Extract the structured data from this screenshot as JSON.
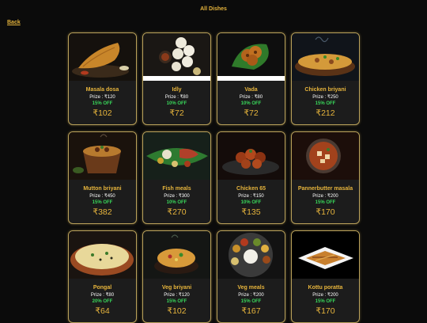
{
  "page": {
    "title": "All Dishes",
    "back_label": "Back"
  },
  "prize_prefix": "Prize : ",
  "dishes": [
    {
      "name": "Masala dosa",
      "prize": "Prize : ₹120",
      "discount": "15% OFF",
      "final_price": "₹102",
      "image": "dosa"
    },
    {
      "name": "Idly",
      "prize": "Prize : ₹80",
      "discount": "10% OFF",
      "final_price": "₹72",
      "image": "idly"
    },
    {
      "name": "Vada",
      "prize": "Prize : ₹80",
      "discount": "10% OFF",
      "final_price": "₹72",
      "image": "vada"
    },
    {
      "name": "Chicken briyani",
      "prize": "Prize : ₹250",
      "discount": "15% OFF",
      "final_price": "₹212",
      "image": "chicken-briyani"
    },
    {
      "name": "Mutton briyani",
      "prize": "Prize : ₹450",
      "discount": "15% OFF",
      "final_price": "₹382",
      "image": "mutton-briyani"
    },
    {
      "name": "Fish meals",
      "prize": "Prize : ₹300",
      "discount": "10% OFF",
      "final_price": "₹270",
      "image": "fish-meals"
    },
    {
      "name": "Chicken 65",
      "prize": "Prize : ₹150",
      "discount": "10% OFF",
      "final_price": "₹135",
      "image": "chicken-65"
    },
    {
      "name": "Pannerbutter masala",
      "prize": "Prize : ₹200",
      "discount": "15% OFF",
      "final_price": "₹170",
      "image": "paneer"
    },
    {
      "name": "Pongal",
      "prize": "Prize : ₹80",
      "discount": "20% OFF",
      "final_price": "₹64",
      "image": "pongal"
    },
    {
      "name": "Veg briyani",
      "prize": "Prize : ₹120",
      "discount": "15% OFF",
      "final_price": "₹102",
      "image": "veg-briyani"
    },
    {
      "name": "Veg meals",
      "prize": "Prize : ₹200",
      "discount": "15% OFF",
      "final_price": "₹167",
      "image": "veg-meals"
    },
    {
      "name": "Kottu poratta",
      "prize": "Prize : ₹200",
      "discount": "15% OFF",
      "final_price": "₹170",
      "image": "kottu"
    }
  ],
  "colors": {
    "accent": "#e6b43c",
    "discount": "#39d65a",
    "card_border": "#b8a05a",
    "background": "#0b0b0b"
  }
}
